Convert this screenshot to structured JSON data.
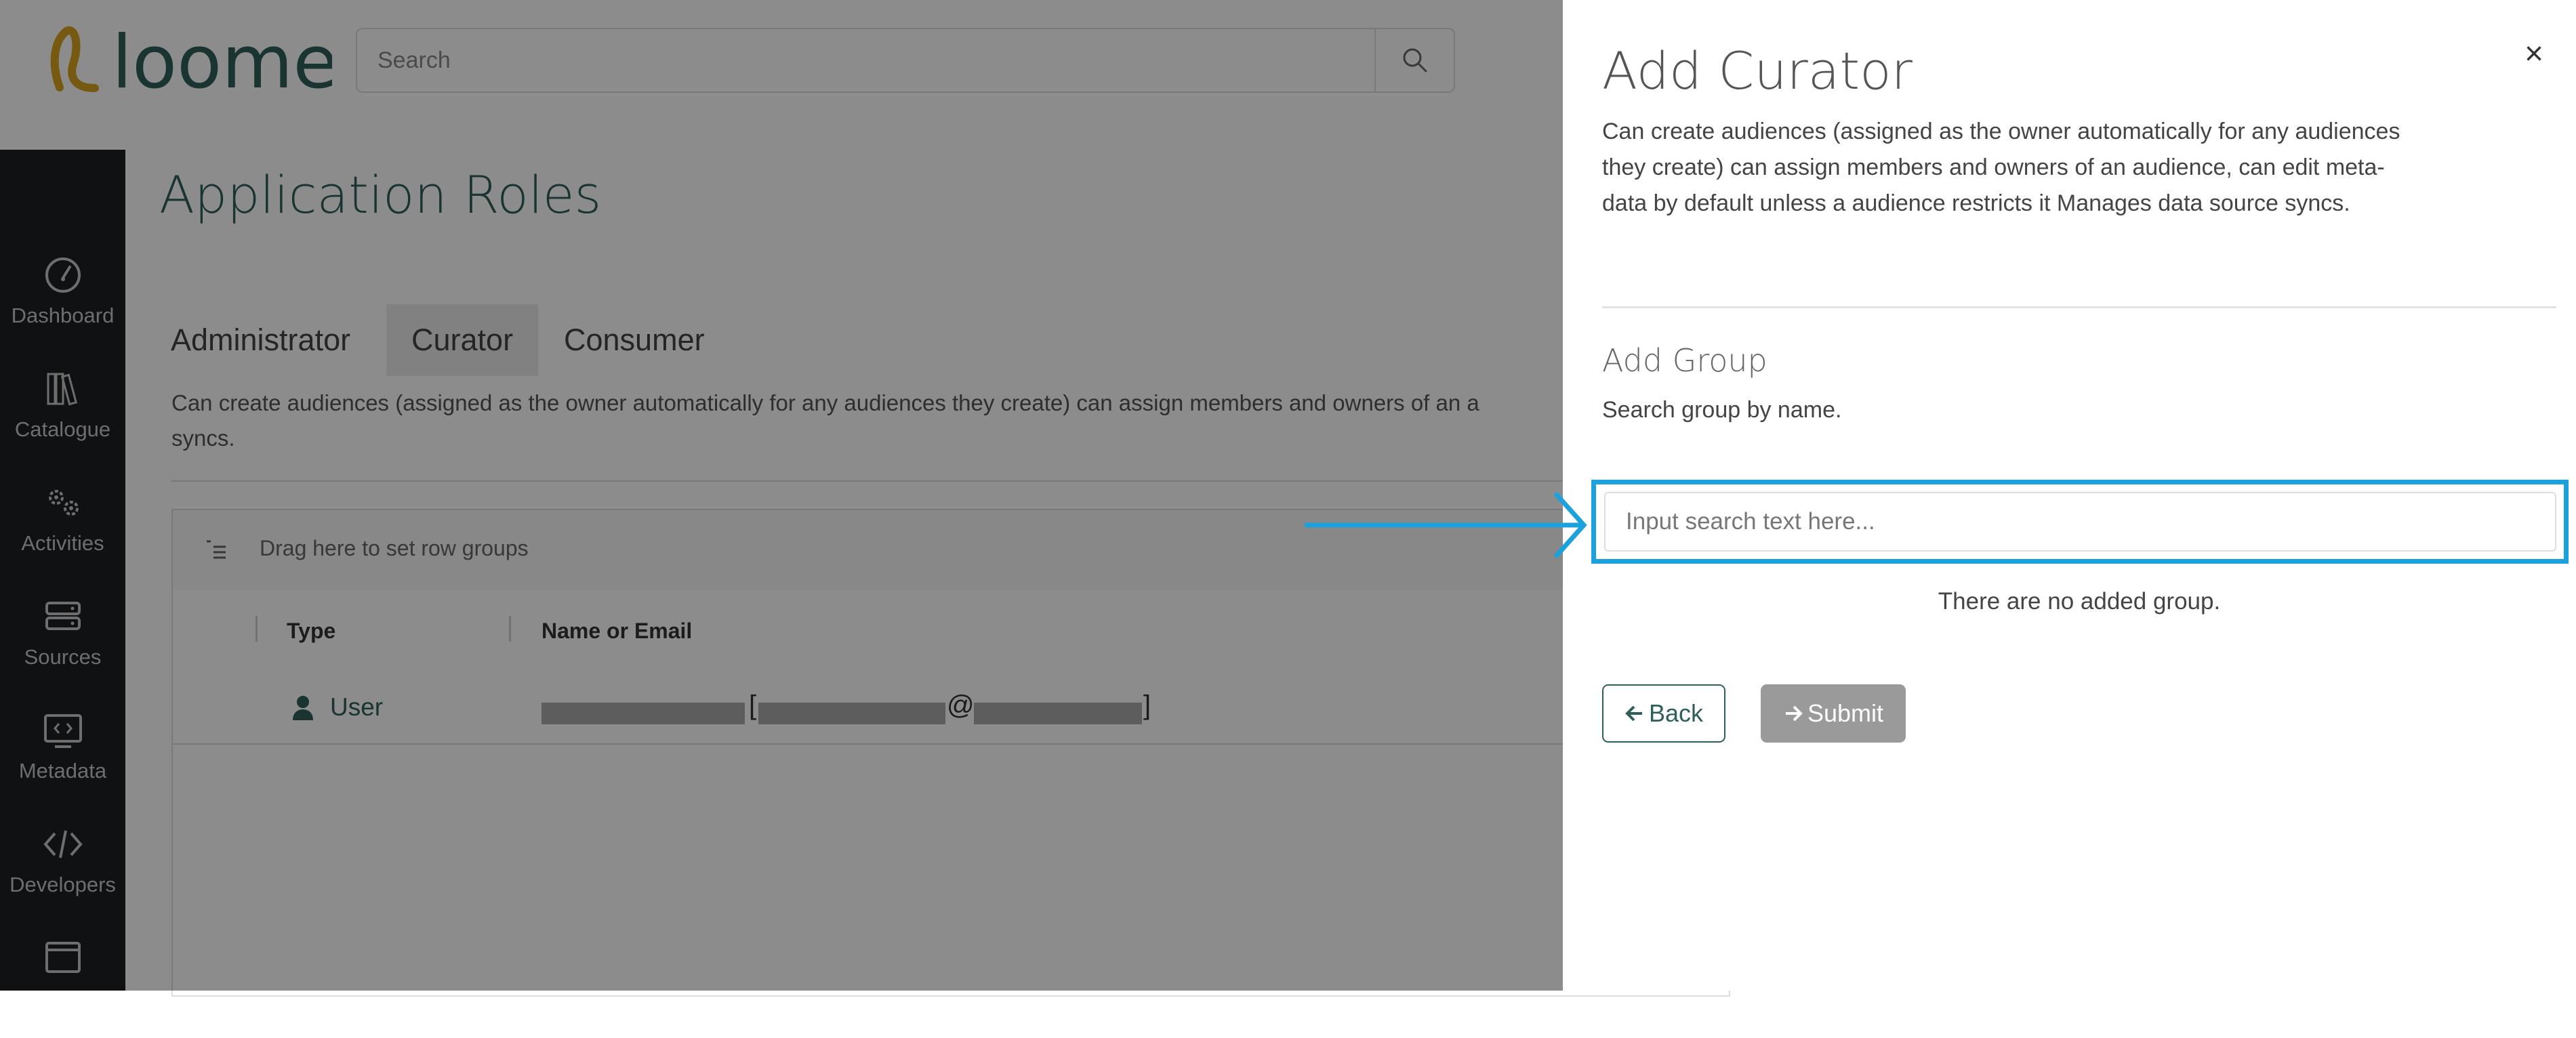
{
  "app": {
    "logo_text": "loome",
    "search": {
      "placeholder": "Search"
    }
  },
  "sidebar": {
    "items": [
      {
        "label": "Dashboard",
        "icon": "dashboard-gauge-icon"
      },
      {
        "label": "Catalogue",
        "icon": "books-icon"
      },
      {
        "label": "Activities",
        "icon": "gears-icon"
      },
      {
        "label": "Sources",
        "icon": "server-icon"
      },
      {
        "label": "Metadata",
        "icon": "code-window-icon"
      },
      {
        "label": "Developers",
        "icon": "code-brackets-icon"
      },
      {
        "label": "",
        "icon": "browser-window-icon"
      }
    ]
  },
  "main": {
    "title": "Application Roles",
    "tabs": [
      {
        "label": "Administrator",
        "active": false
      },
      {
        "label": "Curator",
        "active": true
      },
      {
        "label": "Consumer",
        "active": false
      }
    ],
    "description": "Can create audiences (assigned as the owner automatically for any audiences they create) can assign members and owners of an a",
    "description_wrap": "syncs.",
    "grid": {
      "group_hint": "Drag here to set row groups",
      "columns": [
        "Type",
        "Name or Email"
      ],
      "rows": [
        {
          "type": "User",
          "name_open": "[",
          "name_at": "@",
          "name_close": "]"
        }
      ]
    }
  },
  "drawer": {
    "title": "Add Curator",
    "close_label": "×",
    "description": "Can create audiences (assigned as the owner automatically for any audiences they create) can assign members and owners of an audience, can edit meta-data by default unless a audience restricts it Manages data source syncs.",
    "section_title": "Add Group",
    "help_text": "Search group by name.",
    "search_placeholder": "Input search text here...",
    "empty_text": "There are no added group.",
    "back_label": "Back",
    "submit_label": "Submit"
  },
  "colors": {
    "brand_teal": "#2e5f5a",
    "logo_gold": "#d9a520",
    "highlight_blue": "#1da1dc",
    "sidebar_bg": "#1e1f24",
    "submit_disabled": "#9a9a9a"
  }
}
